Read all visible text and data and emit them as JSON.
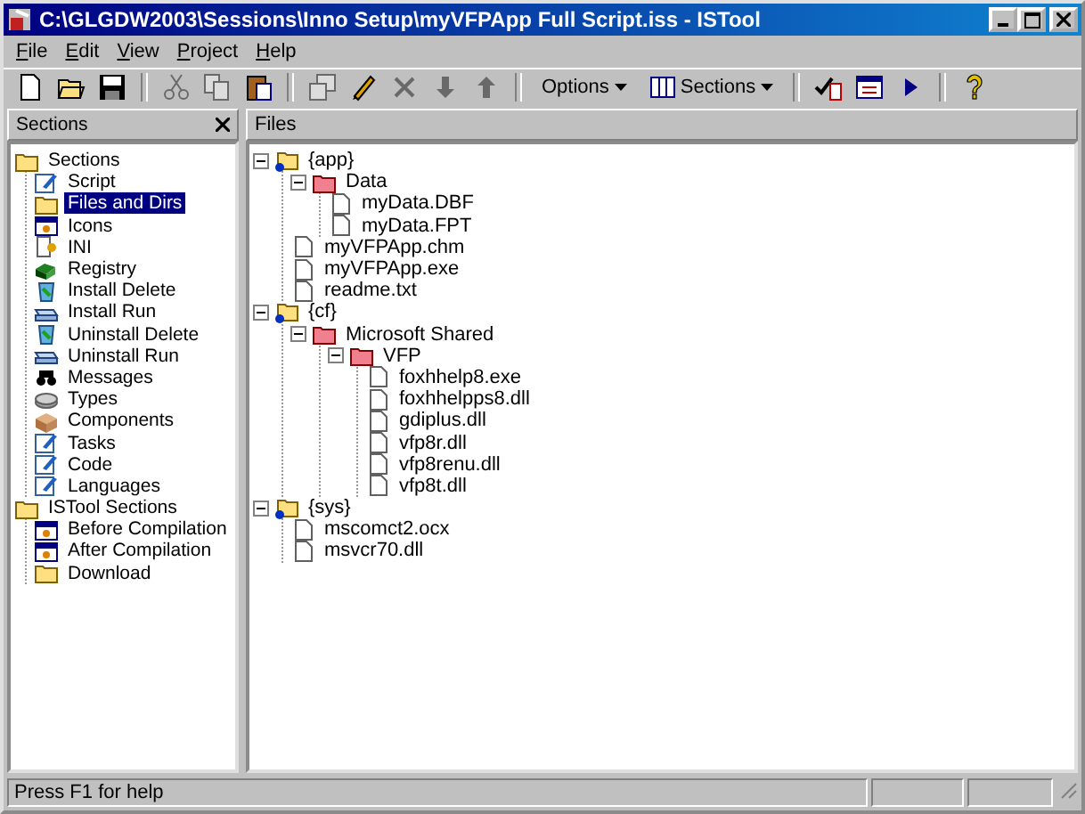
{
  "window": {
    "title": "C:\\GLGDW2003\\Sessions\\Inno Setup\\myVFPApp Full Script.iss - ISTool"
  },
  "menu": [
    "File",
    "Edit",
    "View",
    "Project",
    "Help"
  ],
  "toolbar": [
    {
      "kind": "new",
      "disabled": false
    },
    {
      "kind": "open",
      "disabled": false
    },
    {
      "kind": "save",
      "disabled": false
    },
    {
      "kind": "sep"
    },
    {
      "kind": "cut",
      "disabled": true
    },
    {
      "kind": "copy",
      "disabled": true
    },
    {
      "kind": "paste",
      "disabled": false
    },
    {
      "kind": "sep"
    },
    {
      "kind": "props",
      "disabled": true
    },
    {
      "kind": "pencil",
      "disabled": false
    },
    {
      "kind": "delete",
      "disabled": true
    },
    {
      "kind": "down",
      "disabled": true
    },
    {
      "kind": "up",
      "disabled": true
    },
    {
      "kind": "sep"
    },
    {
      "kind": "menu",
      "label": "Options"
    },
    {
      "kind": "menu",
      "label": "Sections",
      "icon": true
    },
    {
      "kind": "sep"
    },
    {
      "kind": "check",
      "disabled": false
    },
    {
      "kind": "window",
      "disabled": false
    },
    {
      "kind": "run",
      "disabled": false
    },
    {
      "kind": "sep"
    },
    {
      "kind": "help",
      "disabled": false
    }
  ],
  "sections_panel": {
    "title": "Sections",
    "items": [
      {
        "label": "Sections",
        "kind": "folder",
        "selected": false,
        "children": [
          {
            "label": "Script",
            "kind": "pencil",
            "selected": false
          },
          {
            "label": "Files and Dirs",
            "kind": "folder",
            "selected": true
          },
          {
            "label": "Icons",
            "kind": "window",
            "selected": false
          },
          {
            "label": "INI",
            "kind": "page",
            "selected": false
          },
          {
            "label": "Registry",
            "kind": "cube",
            "selected": false
          },
          {
            "label": "Install Delete",
            "kind": "bin",
            "selected": false
          },
          {
            "label": "Install Run",
            "kind": "drive",
            "selected": false
          },
          {
            "label": "Uninstall Delete",
            "kind": "bin",
            "selected": false
          },
          {
            "label": "Uninstall Run",
            "kind": "drive",
            "selected": false
          },
          {
            "label": "Messages",
            "kind": "binoculars",
            "selected": false
          },
          {
            "label": "Types",
            "kind": "disk",
            "selected": false
          },
          {
            "label": "Components",
            "kind": "box",
            "selected": false
          },
          {
            "label": "Tasks",
            "kind": "pencil",
            "selected": false
          },
          {
            "label": "Code",
            "kind": "pencil",
            "selected": false
          },
          {
            "label": "Languages",
            "kind": "pencil",
            "selected": false
          }
        ]
      },
      {
        "label": "ISTool Sections",
        "kind": "folder",
        "selected": false,
        "children": [
          {
            "label": "Before Compilation",
            "kind": "window",
            "selected": false
          },
          {
            "label": "After Compilation",
            "kind": "window",
            "selected": false
          },
          {
            "label": "Download",
            "kind": "folder",
            "selected": false
          }
        ]
      }
    ]
  },
  "files_panel": {
    "title": "Files",
    "items": [
      {
        "label": "{app}",
        "kind": "constant",
        "expanded": true,
        "children": [
          {
            "label": "Data",
            "kind": "folder",
            "expanded": true,
            "children": [
              {
                "label": "myData.DBF",
                "kind": "file"
              },
              {
                "label": "myData.FPT",
                "kind": "file"
              }
            ]
          },
          {
            "label": "myVFPApp.chm",
            "kind": "file"
          },
          {
            "label": "myVFPApp.exe",
            "kind": "file"
          },
          {
            "label": "readme.txt",
            "kind": "file"
          }
        ]
      },
      {
        "label": "{cf}",
        "kind": "constant",
        "expanded": true,
        "children": [
          {
            "label": "Microsoft Shared",
            "kind": "folder",
            "expanded": true,
            "children": [
              {
                "label": "VFP",
                "kind": "folder",
                "expanded": true,
                "children": [
                  {
                    "label": "foxhhelp8.exe",
                    "kind": "file"
                  },
                  {
                    "label": "foxhhelpps8.dll",
                    "kind": "file"
                  },
                  {
                    "label": "gdiplus.dll",
                    "kind": "file"
                  },
                  {
                    "label": "vfp8r.dll",
                    "kind": "file"
                  },
                  {
                    "label": "vfp8renu.dll",
                    "kind": "file"
                  },
                  {
                    "label": "vfp8t.dll",
                    "kind": "file"
                  }
                ]
              }
            ]
          }
        ]
      },
      {
        "label": "{sys}",
        "kind": "constant",
        "expanded": true,
        "children": [
          {
            "label": "mscomct2.ocx",
            "kind": "file"
          },
          {
            "label": "msvcr70.dll",
            "kind": "file"
          }
        ]
      }
    ]
  },
  "status_bar": {
    "text": "Press F1 for help"
  }
}
